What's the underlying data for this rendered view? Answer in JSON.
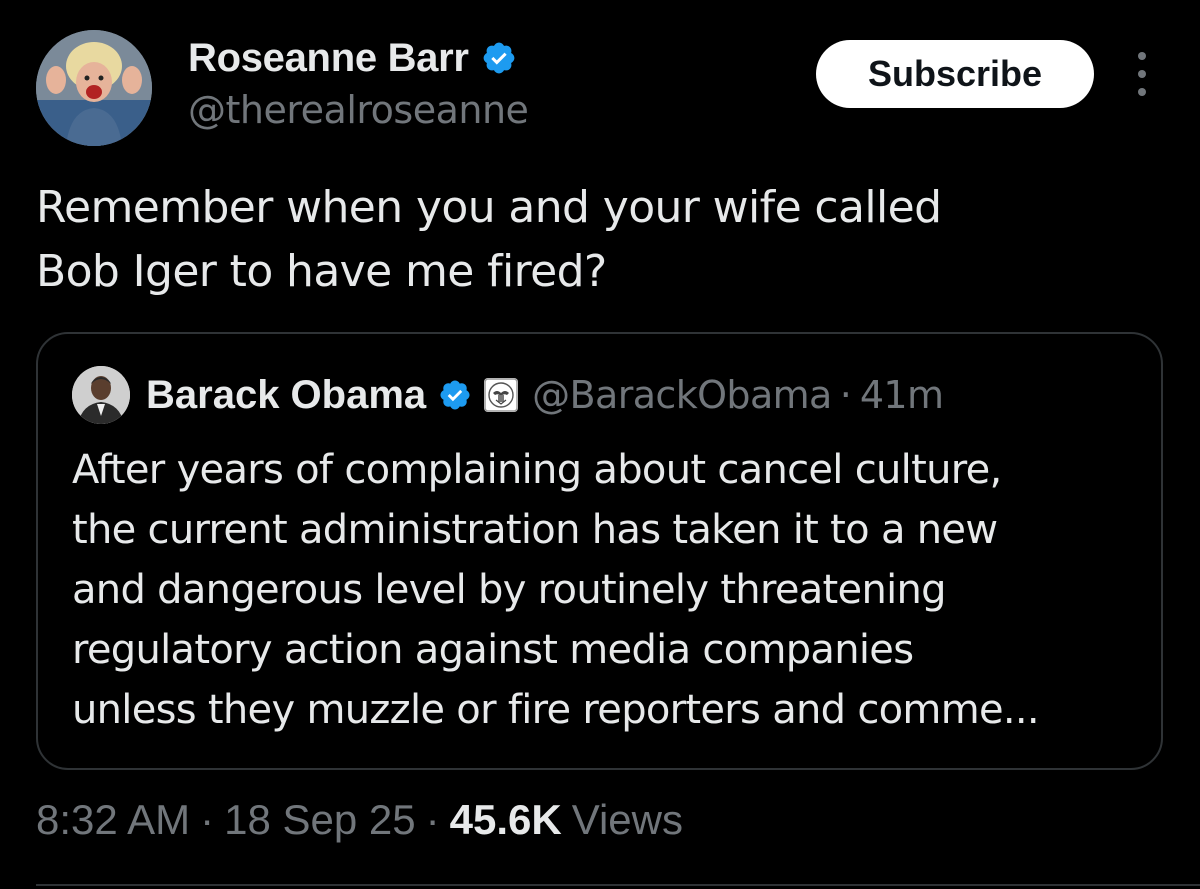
{
  "author": {
    "name": "Roseanne Barr",
    "handle": "@therealroseanne",
    "verified_color": "#1d9bf0"
  },
  "actions": {
    "subscribe_label": "Subscribe",
    "more_icon": "more-dots-icon"
  },
  "tweet": {
    "text_lines": [
      "Remember when you and your wife called",
      "Bob Iger to have me fired?"
    ]
  },
  "quote": {
    "name": "Barack Obama",
    "handle": "@BarackObama",
    "separator": "·",
    "time": "41m",
    "badge_icon": "government-seal-icon",
    "text_lines": [
      "After years of complaining about cancel culture,",
      "the current administration has taken it to a new",
      "and dangerous level by routinely threatening",
      "regulatory action against media companies",
      "unless they muzzle or fire reporters and comme..."
    ]
  },
  "meta": {
    "time": "8:32 AM",
    "date": "18 Sep 25",
    "separator": "·",
    "views_count": "45.6K",
    "views_label": "Views"
  },
  "colors": {
    "background": "#000000",
    "text_primary": "#e7e9ea",
    "text_secondary": "#71767b",
    "border": "#2f3336",
    "verified_blue": "#1d9bf0"
  }
}
